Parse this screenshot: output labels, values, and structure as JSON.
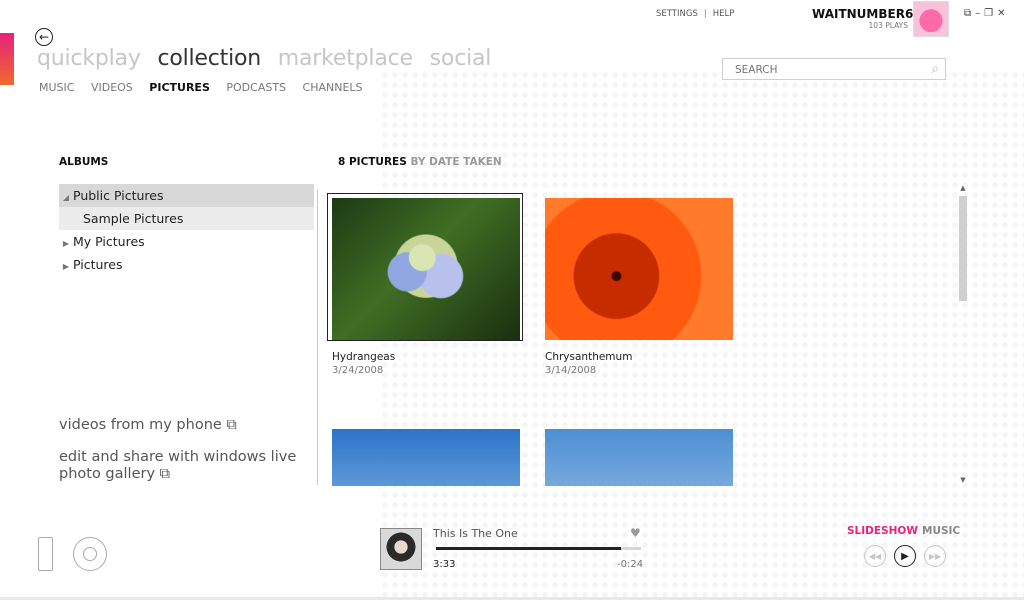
{
  "header": {
    "pivots": [
      "quickplay",
      "collection",
      "marketplace",
      "social"
    ],
    "subnav": [
      "MUSIC",
      "VIDEOS",
      "PICTURES",
      "PODCASTS",
      "CHANNELS"
    ],
    "top_links": {
      "settings": "SETTINGS",
      "help": "HELP",
      "separator": "|"
    },
    "user": {
      "name": "WAITNUMBER6",
      "plays": "103 PLAYS"
    },
    "search": {
      "placeholder": "SEARCH"
    },
    "icons": {
      "back": "back-arrow-icon",
      "search": "magnifier-icon"
    }
  },
  "albums": {
    "title": "ALBUMS",
    "items": [
      {
        "label": "Public Pictures",
        "expanded": true
      },
      {
        "label": "Sample Pictures",
        "child": true
      },
      {
        "label": "My Pictures",
        "expanded": false
      },
      {
        "label": "Pictures",
        "expanded": false
      }
    ]
  },
  "side_links": {
    "phone_videos": "videos from my phone ⧉",
    "live_gallery_line1": "edit and share with windows live",
    "live_gallery_line2": "photo gallery ⧉"
  },
  "grid": {
    "count_label": "8 PICTURES",
    "sort_label": "BY DATE TAKEN",
    "pictures": [
      {
        "title": "Hydrangeas",
        "date": "3/24/2008"
      },
      {
        "title": "Chrysanthemum",
        "date": "3/14/2008"
      },
      {
        "title": "",
        "date": ""
      },
      {
        "title": "",
        "date": ""
      }
    ]
  },
  "now_playing": {
    "title": "This Is The One",
    "elapsed": "3:33",
    "remaining": "-0:24",
    "progress": 0.9
  },
  "playback": {
    "slideshow": "SLIDESHOW",
    "music": "MUSIC",
    "prev": "◀◀",
    "play": "▶",
    "next": "▶▶"
  },
  "colors": {
    "accent": "#e6217e",
    "accent2": "#f06a2a"
  }
}
